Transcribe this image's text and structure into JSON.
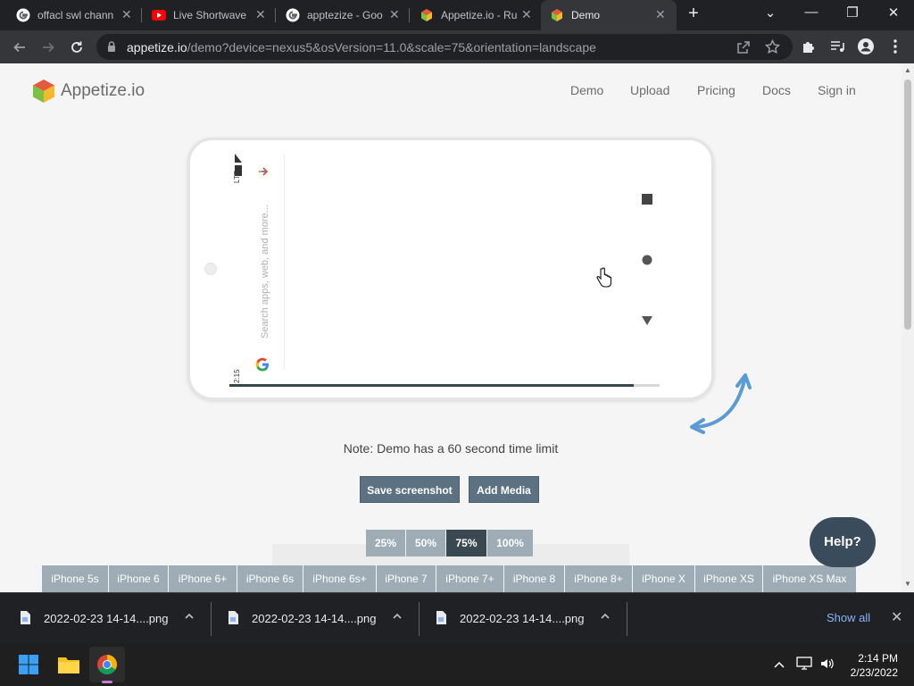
{
  "browser": {
    "tabs": [
      {
        "title": "offacl swl chann",
        "favicon": "google-g-icon"
      },
      {
        "title": "Live Shortwave",
        "favicon": "youtube-icon"
      },
      {
        "title": "apptezize - Goo",
        "favicon": "google-g-icon"
      },
      {
        "title": "Appetize.io - Ru",
        "favicon": "appetize-cube-icon"
      },
      {
        "title": "Demo",
        "favicon": "appetize-cube-icon",
        "active": true
      }
    ],
    "new_tab_symbol": "+",
    "close_symbol": "✕",
    "window_controls": {
      "minimize": "—",
      "restore": "❐",
      "close": "✕",
      "tab_search": "⌄"
    },
    "url_host": "appetize.io",
    "url_path": "/demo?device=nexus5&osVersion=11.0&scale=75&orientation=landscape"
  },
  "site": {
    "logo_text": "Appetize.io",
    "nav": [
      "Demo",
      "Upload",
      "Pricing",
      "Docs",
      "Sign in"
    ]
  },
  "device": {
    "status_time": "2:15",
    "status_network": "LTE",
    "search_placeholder": "Search apps, web, and more...",
    "progress": 0.94
  },
  "note": "Note: Demo has a 60 second time limit",
  "buttons": {
    "save_screenshot": "Save screenshot",
    "add_media": "Add Media"
  },
  "zoom_options": [
    "25%",
    "50%",
    "75%",
    "100%"
  ],
  "zoom_selected": "75%",
  "devices": [
    "iPhone 5s",
    "iPhone 6",
    "iPhone 6+",
    "iPhone 6s",
    "iPhone 6s+",
    "iPhone 7",
    "iPhone 7+",
    "iPhone 8",
    "iPhone 8+",
    "iPhone X",
    "iPhone XS",
    "iPhone XS Max"
  ],
  "help_label": "Help?",
  "downloads": {
    "items": [
      "2022-02-23 14-14....png",
      "2022-02-23 14-14....png",
      "2022-02-23 14-14....png"
    ],
    "show_all": "Show all"
  },
  "taskbar": {
    "time": "2:14 PM",
    "date": "2/23/2022"
  },
  "colors": {
    "accent_dark": "#3a4852",
    "button": "#5c7182",
    "chip": "#9eacb6",
    "help": "#3a4b5c",
    "rotate_arrow": "#5b9bd5"
  }
}
